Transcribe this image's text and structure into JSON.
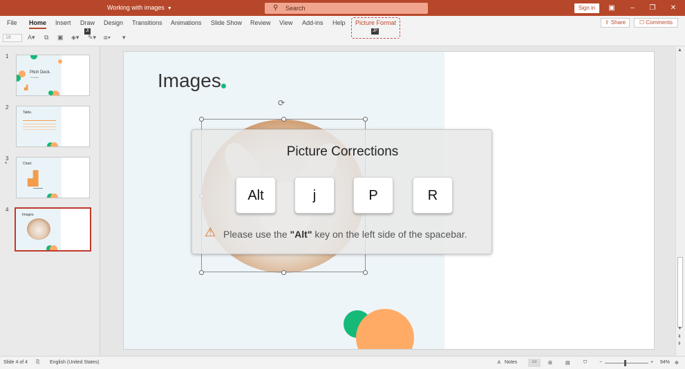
{
  "app": {
    "doc_title": "Working with images",
    "search_label": "Search",
    "sign_in": "Sign in",
    "share": "Share",
    "comments": "Comments"
  },
  "ribbon": {
    "tabs": [
      "File",
      "Home",
      "Insert",
      "Draw",
      "Design",
      "Transitions",
      "Animations",
      "Slide Show",
      "Review",
      "View",
      "Add-ins",
      "Help",
      "Picture Format"
    ],
    "active_tab": "Home",
    "keytips": {
      "draw": "JI",
      "picture_format": "JP"
    },
    "font_size": "18"
  },
  "slides": [
    {
      "number": "1",
      "title": "Pitch Deck.",
      "subtitle": "Template"
    },
    {
      "number": "2",
      "title": "Table."
    },
    {
      "number": "3",
      "title": "Chart.",
      "star": "*"
    },
    {
      "number": "4",
      "title": "Images.",
      "selected": true
    }
  ],
  "slide": {
    "title": "Images"
  },
  "overlay": {
    "title": "Picture Corrections",
    "keys": [
      "Alt",
      "j",
      "P",
      "R"
    ],
    "message_prefix": "Please use the ",
    "message_key": "\"Alt\"",
    "message_suffix": " key on the left side of the spacebar."
  },
  "status": {
    "slide_info": "Slide 4 of 4",
    "language": "English (United States)",
    "notes": "Notes",
    "zoom": "94%"
  },
  "colors": {
    "accent": "#b7472a",
    "green": "#17b978",
    "orange": "#ffab66",
    "selection": "#c0392b"
  }
}
